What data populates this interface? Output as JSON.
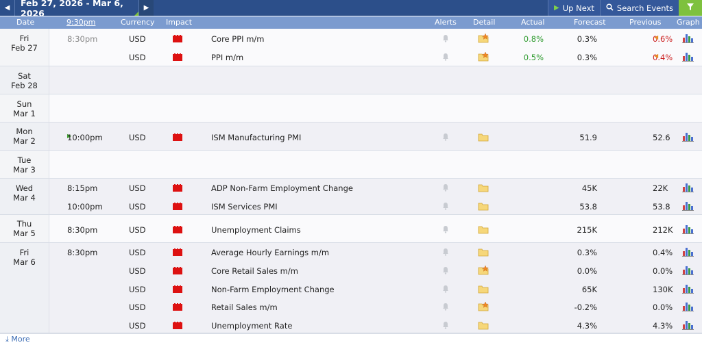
{
  "toolbar": {
    "date_range": "Feb 27, 2026 - Mar 6, 2026",
    "up_next": "Up Next",
    "search_events": "Search Events"
  },
  "columns": {
    "date": "Date",
    "time": "9:30pm",
    "currency": "Currency",
    "impact": "Impact",
    "alerts": "Alerts",
    "detail": "Detail",
    "actual": "Actual",
    "forecast": "Forecast",
    "previous": "Previous",
    "graph": "Graph"
  },
  "days": [
    {
      "day": "Fri",
      "date": "Feb 27",
      "shade": "w",
      "events": [
        {
          "time": "8:30pm",
          "past": true,
          "currency": "USD",
          "name": "Core PPI m/m",
          "star": true,
          "actual": "0.8%",
          "actual_color": "green",
          "forecast": "0.3%",
          "previous": "0.6%",
          "prev_color": "red",
          "revised": true,
          "graph": true
        },
        {
          "time": "",
          "currency": "USD",
          "name": "PPI m/m",
          "star": true,
          "actual": "0.5%",
          "actual_color": "green",
          "forecast": "0.3%",
          "previous": "0.4%",
          "prev_color": "red",
          "revised": true,
          "graph": true
        }
      ]
    },
    {
      "day": "Sat",
      "date": "Feb 28",
      "shade": "g",
      "events": []
    },
    {
      "day": "Sun",
      "date": "Mar 1",
      "shade": "w",
      "events": []
    },
    {
      "day": "Mon",
      "date": "Mar 2",
      "shade": "g",
      "events": [
        {
          "time": "10:00pm",
          "next": true,
          "currency": "USD",
          "name": "ISM Manufacturing PMI",
          "star": false,
          "actual": "",
          "forecast": "51.9",
          "previous": "52.6",
          "graph": true
        }
      ]
    },
    {
      "day": "Tue",
      "date": "Mar 3",
      "shade": "w",
      "events": []
    },
    {
      "day": "Wed",
      "date": "Mar 4",
      "shade": "g",
      "events": [
        {
          "time": "8:15pm",
          "currency": "USD",
          "name": "ADP Non-Farm Employment Change",
          "star": false,
          "actual": "",
          "forecast": "45K",
          "previous": "22K",
          "graph": true
        },
        {
          "time": "10:00pm",
          "currency": "USD",
          "name": "ISM Services PMI",
          "star": false,
          "actual": "",
          "forecast": "53.8",
          "previous": "53.8",
          "graph": true
        }
      ]
    },
    {
      "day": "Thu",
      "date": "Mar 5",
      "shade": "w",
      "events": [
        {
          "time": "8:30pm",
          "currency": "USD",
          "name": "Unemployment Claims",
          "star": false,
          "actual": "",
          "forecast": "215K",
          "previous": "212K",
          "graph": true
        }
      ]
    },
    {
      "day": "Fri",
      "date": "Mar 6",
      "shade": "g",
      "events": [
        {
          "time": "8:30pm",
          "currency": "USD",
          "name": "Average Hourly Earnings m/m",
          "star": false,
          "actual": "",
          "forecast": "0.3%",
          "previous": "0.4%",
          "graph": true
        },
        {
          "time": "",
          "currency": "USD",
          "name": "Core Retail Sales m/m",
          "star": true,
          "actual": "",
          "forecast": "0.0%",
          "previous": "0.0%",
          "graph": true
        },
        {
          "time": "",
          "currency": "USD",
          "name": "Non-Farm Employment Change",
          "star": false,
          "actual": "",
          "forecast": "65K",
          "previous": "130K",
          "graph": true
        },
        {
          "time": "",
          "currency": "USD",
          "name": "Retail Sales m/m",
          "star": true,
          "actual": "",
          "forecast": "-0.2%",
          "previous": "0.0%",
          "graph": true
        },
        {
          "time": "",
          "currency": "USD",
          "name": "Unemployment Rate",
          "star": false,
          "actual": "",
          "forecast": "4.3%",
          "previous": "4.3%",
          "graph": true
        }
      ]
    }
  ],
  "footer": {
    "more": "More"
  },
  "colors": {
    "header_bar": "#2c4f8a",
    "column_header": "#7b9bcf",
    "filter": "#7ec13e",
    "impact_high": "#dd1111",
    "actual_better": "#2d9a2d",
    "previous_worse": "#cc2222"
  }
}
